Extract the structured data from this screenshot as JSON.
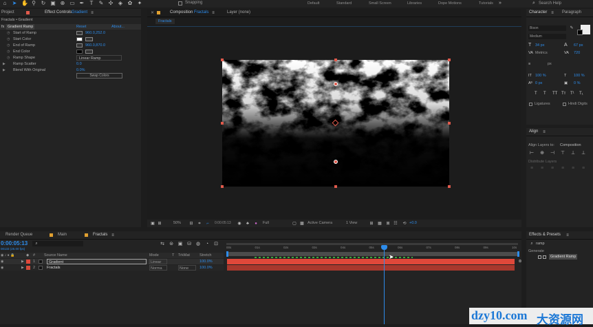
{
  "toolbar": {
    "snapping": "Snapping",
    "icons": [
      "home-icon",
      "selection-tool-icon",
      "hand-tool-icon",
      "zoom-tool-icon",
      "rotate-tool-icon",
      "camera-tool-icon",
      "pan-behind-icon",
      "rectangle-tool-icon",
      "pen-tool-icon",
      "type-tool-icon",
      "brush-tool-icon",
      "clone-stamp-icon",
      "eraser-tool-icon",
      "roto-brush-icon",
      "puppet-tool-icon"
    ]
  },
  "workspaces": [
    "Default",
    "Standard",
    "Small Screen",
    "Libraries",
    "Dope Motions",
    "Tutorials"
  ],
  "workspace_active": "Tutorials",
  "search_help": "Search Help",
  "project_tab": "Project",
  "effect_controls": {
    "tab_prefix": "Effect Controls",
    "tab_layer": "Gradient",
    "breadcrumb": "Fractals • Gradient",
    "effect_name": "Gradient Ramp",
    "reset": "Reset",
    "about": "About...",
    "props": [
      {
        "label": "Start of Ramp",
        "value": "960.0,252.0"
      },
      {
        "label": "Start Color",
        "value": ""
      },
      {
        "label": "End of Ramp",
        "value": "960.0,870.0"
      },
      {
        "label": "End Color",
        "value": ""
      },
      {
        "label": "Ramp Shape",
        "value": "Linear Ramp"
      },
      {
        "label": "Ramp Scatter",
        "value": "0.0"
      },
      {
        "label": "Blend With Original",
        "value": "0.0%"
      }
    ],
    "swap": "Swap Colors"
  },
  "composition": {
    "tab": "Composition",
    "name": "Fractals",
    "layer_none": "Layer (none)",
    "subtab": "Fractals",
    "footer": {
      "zoom": "50%",
      "time": "0:00:05:13",
      "resolution": "Full",
      "camera": "Active Camera",
      "views": "1 View",
      "exposure": "+0.0"
    }
  },
  "character": {
    "tab": "Character",
    "tab2": "Paragraph",
    "font": "Bison",
    "style": "Medium",
    "size": "34 px",
    "leading": "67 px",
    "kern_label": "Metrics",
    "tracking": "720",
    "stroke": "px",
    "vscale": "100 %",
    "hscale": "100 %",
    "baseline": "0 px",
    "tsume": "0 %",
    "ligatures": "Ligatures",
    "hindi": "Hindi Digits",
    "styles": [
      "T",
      "T",
      "TT",
      "Tт",
      "T¹",
      "T₁"
    ]
  },
  "align": {
    "tab": "Align",
    "align_to_label": "Align Layers to:",
    "align_to": "Composition",
    "distribute": "Distribute Layers"
  },
  "effects_presets": {
    "tab": "Effects & Presets",
    "search": "ramp",
    "category": "Generate",
    "item": "Gradient Ramp"
  },
  "timeline": {
    "tabs": [
      "Render Queue",
      "Main",
      "Fractals"
    ],
    "time": "0:00:05:13",
    "fps": "00133 (25.00 fps)",
    "columns": [
      "#",
      "Source Name",
      "Mode",
      "T",
      "TrkMat",
      "Stretch"
    ],
    "layers": [
      {
        "num": "1",
        "name": "Gradient",
        "mode": "Linear",
        "trkmat": "",
        "stretch": "100.0%",
        "color": "#e0483a"
      },
      {
        "num": "2",
        "name": "Fractals",
        "mode": "Norma",
        "trkmat": "None",
        "stretch": "100.0%",
        "color": "#d44a3a"
      }
    ],
    "ruler": [
      "00s",
      "01s",
      "02s",
      "03s",
      "04s",
      "05s",
      "06s",
      "07s",
      "08s",
      "09s",
      "10s"
    ]
  },
  "watermark": {
    "latin": "dzy10.com",
    "cjk": "大资源网"
  },
  "colors": {
    "accent": "#2d8ceb",
    "layer_bar": "#e0483a",
    "layer_bar2": "#a8382d",
    "handle": "#e05a4c"
  }
}
